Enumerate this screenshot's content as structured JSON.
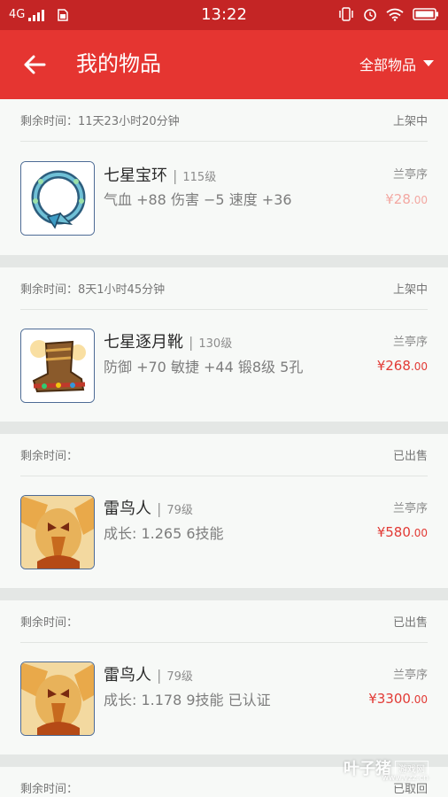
{
  "status_bar": {
    "network": "4G",
    "time": "13:22"
  },
  "header": {
    "title": "我的物品",
    "filter_label": "全部物品"
  },
  "items": [
    {
      "remaining": "剩余时间：11天23小时20分钟",
      "status": "上架中",
      "name": "七星宝环",
      "level": "115级",
      "attrs": "气血 +88 伤害 −5 速度 +36",
      "seller": "兰亭序",
      "price_main": "¥28",
      "price_dec": ".00"
    },
    {
      "remaining": "剩余时间：8天1小时45分钟",
      "status": "上架中",
      "name": "七星逐月靴",
      "level": "130级",
      "attrs": "防御 +70 敏捷 +44 锻8级 5孔",
      "seller": "兰亭序",
      "price_main": "¥268",
      "price_dec": ".00"
    },
    {
      "remaining": "剩余时间：",
      "status": "已出售",
      "name": "雷鸟人",
      "level": "79级",
      "attrs": "成长: 1.265  6技能",
      "seller": "兰亭序",
      "price_main": "¥580",
      "price_dec": ".00"
    },
    {
      "remaining": "剩余时间：",
      "status": "已出售",
      "name": "雷鸟人",
      "level": "79级",
      "attrs": "成长: 1.178  9技能  已认证",
      "seller": "兰亭序",
      "price_main": "¥3300",
      "price_dec": ".00"
    },
    {
      "remaining": "剩余时间：",
      "status": "已取回"
    }
  ],
  "watermark": {
    "brand": "叶子猪",
    "sub": "游戏网",
    "url": "www.yzz.cn"
  }
}
